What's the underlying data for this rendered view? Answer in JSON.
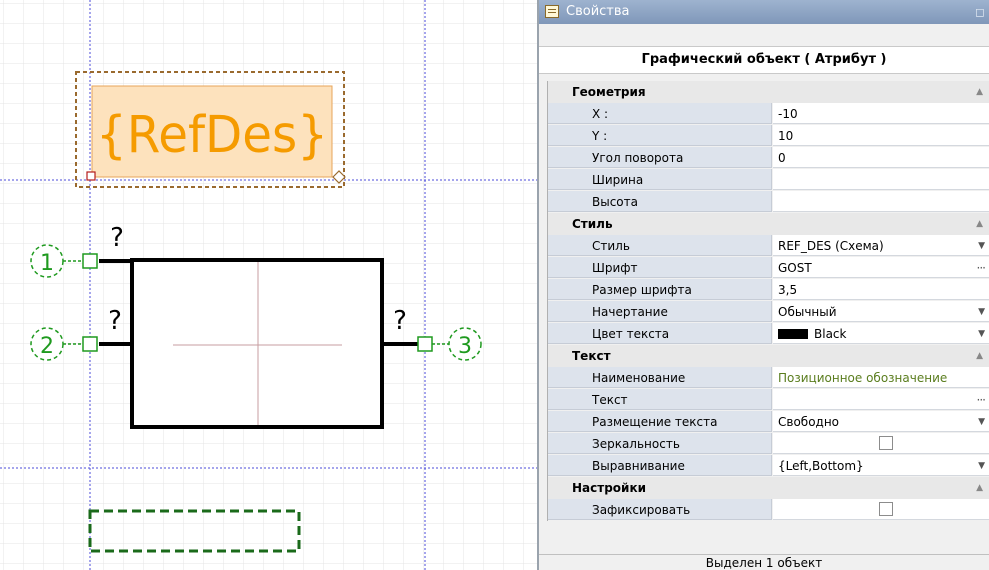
{
  "canvas": {
    "refdes_text": "{RefDes}",
    "pin_markers": [
      "?",
      "?",
      "?"
    ],
    "pin_numbers": [
      "1",
      "2",
      "3"
    ]
  },
  "panel": {
    "title": "Свойства",
    "object_header": "Графический объект ( Атрибут )",
    "categories": [
      {
        "label": "Геометрия",
        "rows": [
          {
            "name": "X :",
            "value": "-10"
          },
          {
            "name": "Y :",
            "value": "10"
          },
          {
            "name": "Угол поворота",
            "value": "0"
          },
          {
            "name": "Ширина",
            "value": ""
          },
          {
            "name": "Высота",
            "value": ""
          }
        ]
      },
      {
        "label": "Стиль",
        "rows": [
          {
            "name": "Стиль",
            "value": "REF_DES (Схема)"
          },
          {
            "name": "Шрифт",
            "value": "GOST"
          },
          {
            "name": "Размер шрифта",
            "value": "3,5"
          },
          {
            "name": "Начертание",
            "value": "Обычный"
          },
          {
            "name": "Цвет текста",
            "value": "Black",
            "swatch_color": "#000000"
          }
        ]
      },
      {
        "label": "Текст",
        "rows": [
          {
            "name": "Наименование",
            "value": "Позиционное обозначение"
          },
          {
            "name": "Текст",
            "value": ""
          },
          {
            "name": "Размещение текста",
            "value": "Свободно"
          },
          {
            "name": "Зеркальность",
            "value": false
          },
          {
            "name": "Выравнивание",
            "value": "{Left,Bottom}"
          }
        ]
      },
      {
        "label": "Настройки",
        "rows": [
          {
            "name": "Зафиксировать",
            "value": false
          }
        ]
      }
    ],
    "status": "Выделен 1 объект"
  },
  "colors": {
    "refdes_text": "#f59b00",
    "refdes_fill": "#fde2bd",
    "selection_border": "#9a6a2e",
    "pin_green": "#1f9a1f",
    "guide_blue": "#4b4bd8",
    "name_cell_bg": "#dde3ec",
    "category_bg": "#e8e8e8",
    "value_green": "#5a7d1e"
  },
  "icons": {
    "title_icon": "properties-icon",
    "collapse": "chevron-up-icon",
    "dropdown": "dropdown-arrow-icon",
    "ellipsis": "ellipsis-icon"
  }
}
